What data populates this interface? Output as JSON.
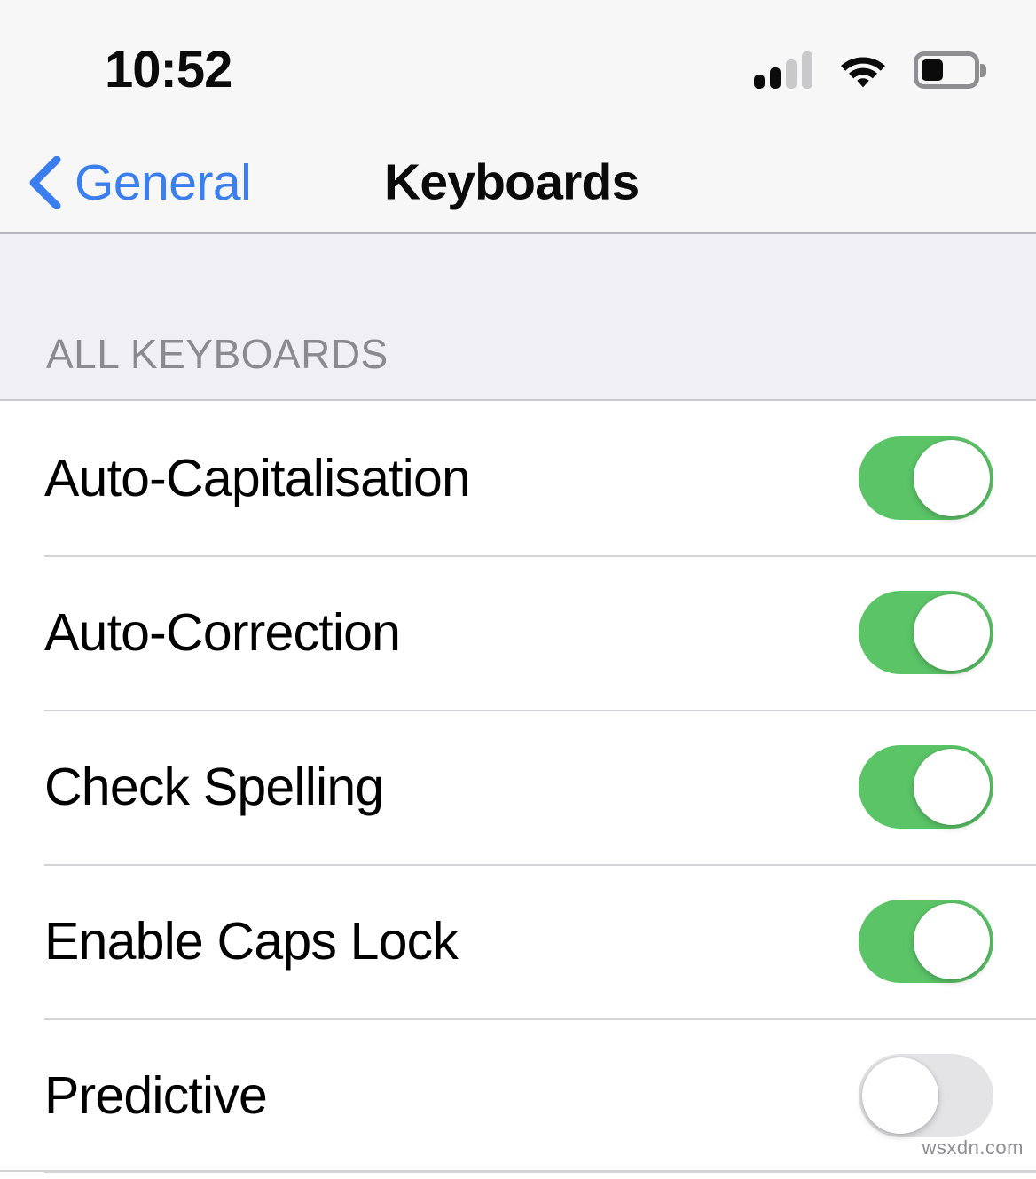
{
  "status_bar": {
    "time": "10:52",
    "signal_icon": "cellular-signal-icon",
    "signal_bars_filled": 2,
    "signal_bars_total": 4,
    "wifi_icon": "wifi-icon",
    "wifi_strength": "full",
    "battery_icon": "battery-icon",
    "battery_percent": 38
  },
  "nav_bar": {
    "back_icon": "chevron-left-icon",
    "back_label": "General",
    "title": "Keyboards"
  },
  "section": {
    "header": "ALL KEYBOARDS"
  },
  "rows": [
    {
      "label": "Auto-Capitalisation",
      "toggle": "on",
      "toggle_name": "toggle-auto-capitalisation"
    },
    {
      "label": "Auto-Correction",
      "toggle": "on",
      "toggle_name": "toggle-auto-correction"
    },
    {
      "label": "Check Spelling",
      "toggle": "on",
      "toggle_name": "toggle-check-spelling"
    },
    {
      "label": "Enable Caps Lock",
      "toggle": "on",
      "toggle_name": "toggle-enable-caps-lock"
    },
    {
      "label": "Predictive",
      "toggle": "off",
      "toggle_name": "toggle-predictive"
    }
  ],
  "watermark": "wsxdn.com",
  "colors": {
    "accent_blue": "#3b7ef0",
    "toggle_on_green": "#5bc467",
    "toggle_off_gray": "#e4e4e6",
    "bar_background": "#f7f7f7",
    "group_background": "#efeff4",
    "separator": "#d4d4d6",
    "section_header_text": "#8a8a8f"
  }
}
